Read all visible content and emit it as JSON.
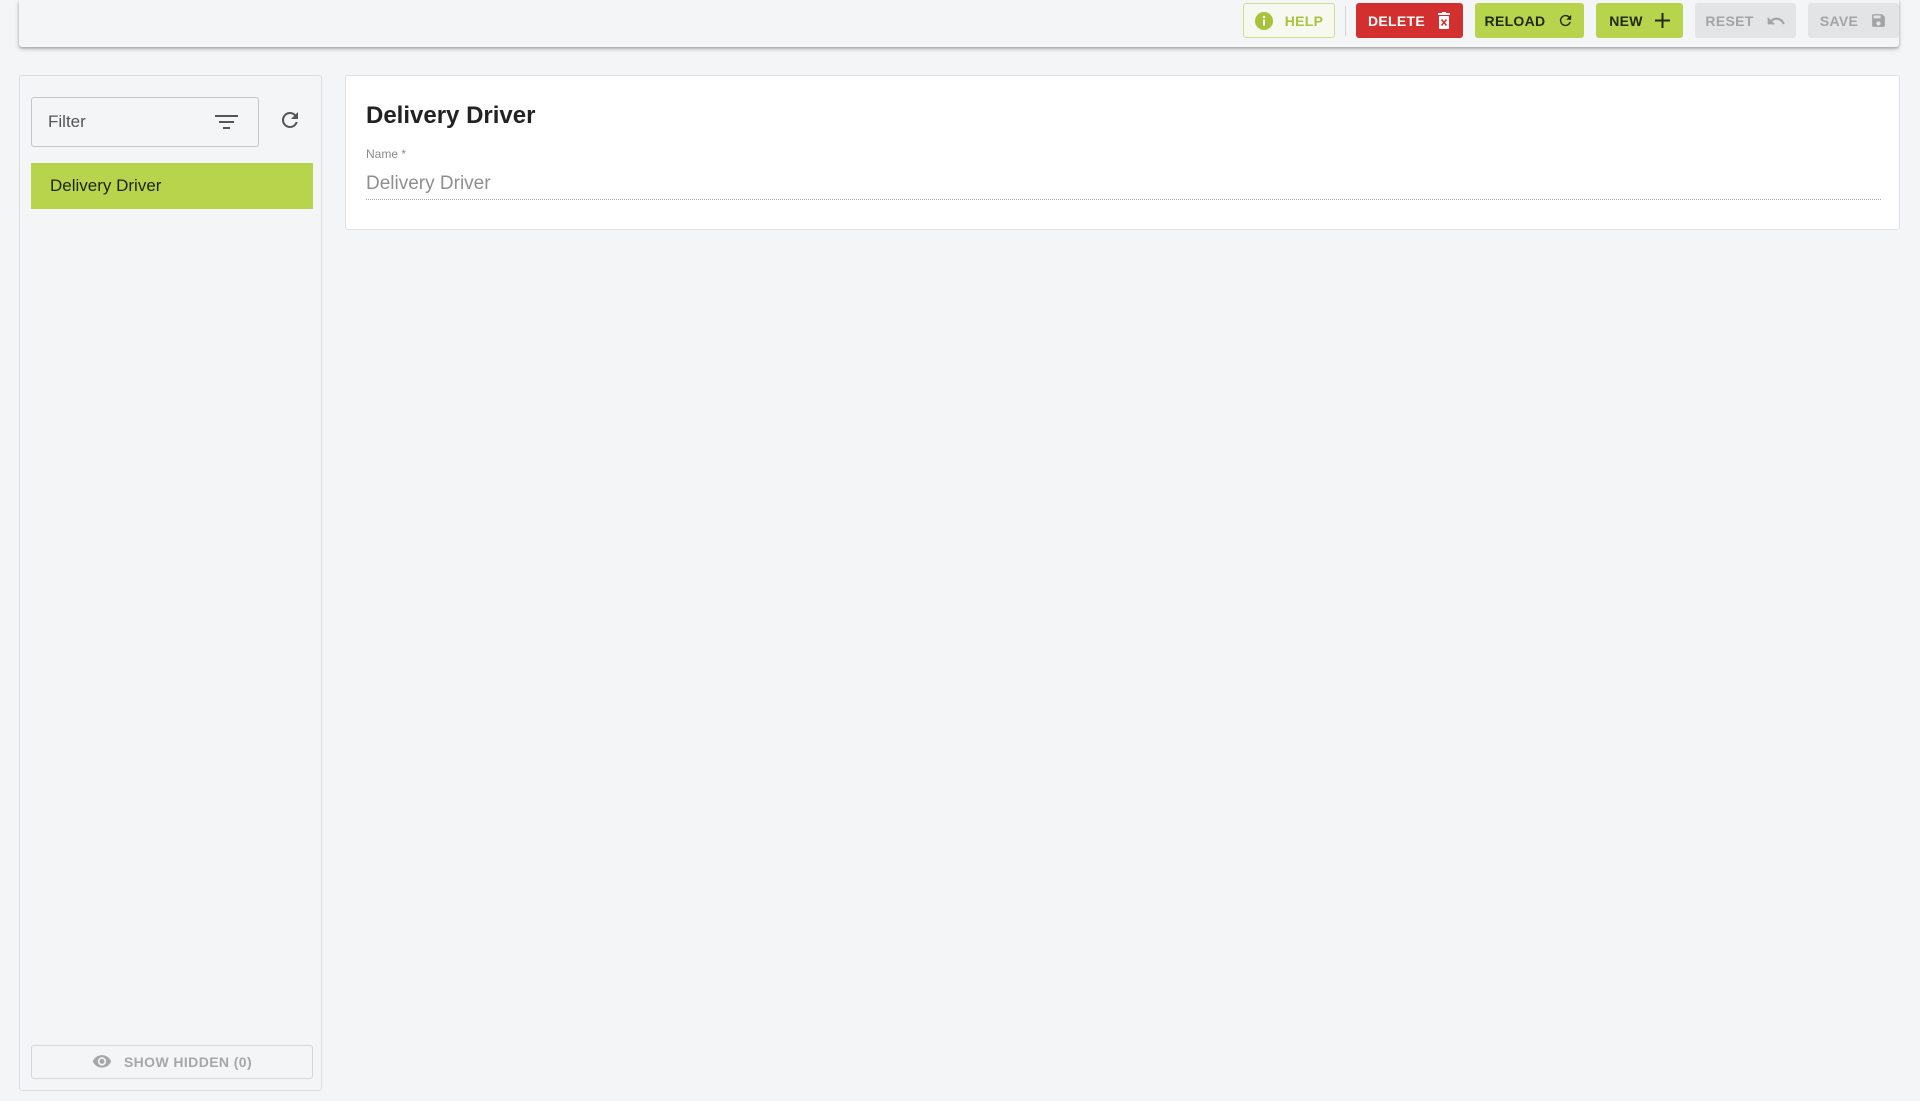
{
  "toolbar": {
    "help_label": "HELP",
    "delete_label": "DELETE",
    "reload_label": "RELOAD",
    "new_label": "NEW",
    "reset_label": "RESET",
    "save_label": "SAVE",
    "icons": {
      "help": "info-icon",
      "delete": "trash-icon",
      "reload": "refresh-icon",
      "new": "plus-icon",
      "reset": "undo-icon",
      "save": "floppy-disk-icon"
    }
  },
  "sidebar": {
    "filter_placeholder": "Filter",
    "filter_value": "",
    "items": [
      {
        "label": "Delivery Driver",
        "selected": true
      }
    ],
    "show_hidden_label": "SHOW HIDDEN (0)"
  },
  "detail": {
    "title": "Delivery Driver",
    "name_label": "Name *",
    "name_value": "Delivery Driver"
  },
  "colors": {
    "accent": "#b8d44c",
    "danger": "#d32f2f",
    "disabled": "#e3e4e6",
    "background": "#f4f5f7"
  }
}
